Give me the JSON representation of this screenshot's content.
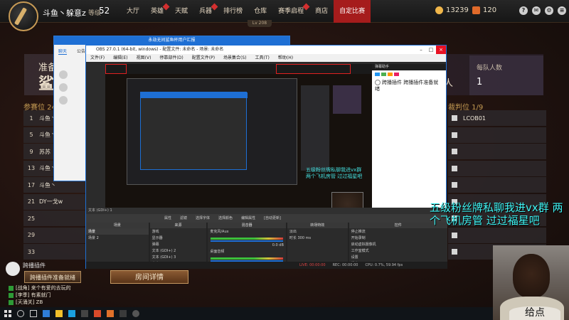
{
  "header": {
    "player_name": "斗鱼丶躲意z",
    "level_label": "等级",
    "level_value": "52",
    "nav": [
      {
        "label": "大厅",
        "active": false,
        "dot": false
      },
      {
        "label": "英雄",
        "active": false,
        "dot": true
      },
      {
        "label": "天赋",
        "active": false,
        "dot": false
      },
      {
        "label": "兵器",
        "active": false,
        "dot": true
      },
      {
        "label": "排行榜",
        "active": false,
        "dot": false
      },
      {
        "label": "仓库",
        "active": false,
        "dot": false
      },
      {
        "label": "赛季启程",
        "active": false,
        "dot": true
      },
      {
        "label": "商店",
        "active": false,
        "dot": false
      },
      {
        "label": "自定比赛",
        "active": true,
        "dot": false
      }
    ],
    "lv_tab": "Lv 208",
    "currency_1": "13239",
    "currency_2": "120",
    "colors": {
      "accent": "#a61c1c",
      "gold": "#c59b53",
      "overlay_cyan": "#3ff2f2"
    }
  },
  "match": {
    "mode_prefix": "准备",
    "mode_title": "鲨",
    "team_count_label": "每队人数",
    "team_count_value": "1",
    "team_unit": "人",
    "left_title": "参赛位 24",
    "left_rows": [
      {
        "num": "1",
        "name": "斗鱼丶"
      },
      {
        "num": "5",
        "name": "斗鱼丶"
      },
      {
        "num": "9",
        "name": "苏苏"
      },
      {
        "num": "13",
        "name": "斗鱼丶"
      },
      {
        "num": "17",
        "name": "斗鱼丶"
      },
      {
        "num": "21",
        "name": "DY一戈w"
      },
      {
        "num": "25",
        "name": ""
      },
      {
        "num": "29",
        "name": ""
      },
      {
        "num": "33",
        "name": ""
      }
    ],
    "right_title": "裁判位 1/9",
    "right_rows": [
      "LCOB01",
      "",
      "",
      "",
      "",
      "",
      "",
      "",
      ""
    ]
  },
  "chat": {
    "plugin_name": "跨播插件",
    "leave_button": "跨播插件准备就绪",
    "room_button": "房间详情",
    "lines": [
      "[战角] 来个有爱的去玩的",
      "[李季] 有素就门",
      "[天涌关] ZB"
    ]
  },
  "obs": {
    "bg_window_title": "永劫无间鲨鱼杯用户汇报",
    "bg_tabs": [
      "聊天",
      "公告"
    ],
    "title": "OBS 27.0.1 (64-bit, windows) - 配置文件: 未命名 - 场景: 未命名",
    "menu": [
      "文件(F)",
      "编辑(E)",
      "视图(V)",
      "停靠部件(D)",
      "配置文件(P)",
      "场景集合(S)",
      "工具(T)",
      "帮助(H)"
    ],
    "right_panel_head": "弹幕助手",
    "right_panel_msg": "跨播插件 跨播插件准备就绪",
    "mini_overlay": "五级粉丝牌私聊我进vx群 两个飞机房管 过过福星吧",
    "mini_face_label": "给点",
    "status_strip": "文本 (GDI+) 1",
    "controls": [
      "属性",
      "滤镜",
      "选择字体",
      "选择颜色",
      "编辑属性",
      "[自动更新]"
    ],
    "docks": [
      {
        "title": "场景",
        "items": [
          "场景",
          "场景 2"
        ]
      },
      {
        "title": "来源",
        "items": [
          "游戏",
          "显示器",
          "弹幕",
          "文本 (GDI+) 2",
          "文本 (GDI+) 3",
          "文本 (GDI+) 1"
        ]
      },
      {
        "title": "混音器",
        "items": [
          "麦克风/Aux",
          "桌面音频"
        ]
      },
      {
        "title": "转场特效",
        "items": [
          "淡出",
          "时长 300 ms"
        ]
      },
      {
        "title": "控件",
        "items": [
          "停止推流",
          "开始录制",
          "启动虚拟摄像机",
          "工作室模式",
          "设置",
          "退出"
        ]
      }
    ],
    "mixer_values": [
      "0.0 dB",
      "-2.5 dB"
    ],
    "transition_name": "淡出",
    "transition_duration": "300 ms",
    "bottom": {
      "live": "LIVE: 00:00:00",
      "rec": "REC: 00:00:00",
      "cpu": "CPU: 0.7%, 59.94 fps"
    }
  },
  "stream_overlay": {
    "text": "五级粉丝牌私聊我进vx群 两个飞机房管 过过福星吧",
    "cam_label": "给点"
  }
}
